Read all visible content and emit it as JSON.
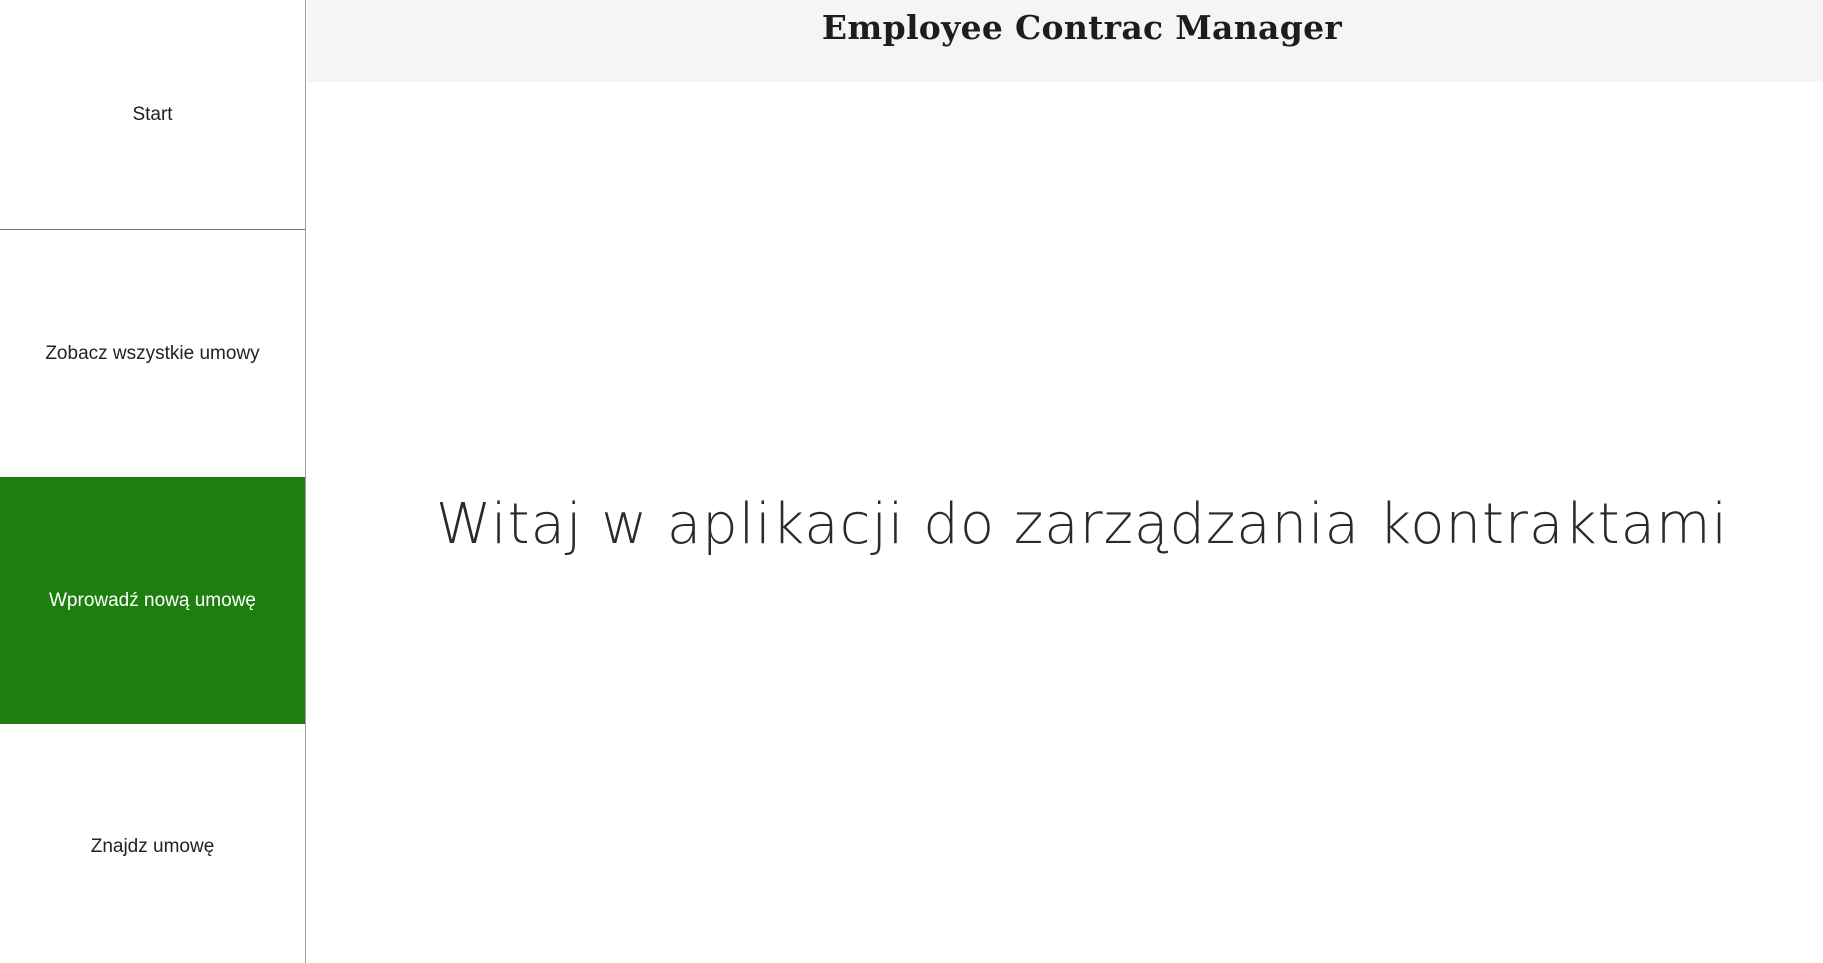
{
  "header": {
    "title": "Employee Contrac Manager"
  },
  "sidebar": {
    "items": [
      {
        "label": "Start"
      },
      {
        "label": "Zobacz wszystkie umowy"
      },
      {
        "label": "Wprowadź nową umowę"
      },
      {
        "label": "Znajdz umowę"
      }
    ],
    "active_color": "#1e7f10"
  },
  "main": {
    "welcome_text": "Witaj w aplikacji do zarządzania kontraktami"
  }
}
